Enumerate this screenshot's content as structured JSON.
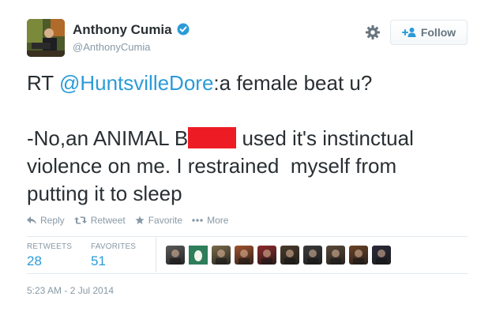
{
  "author": {
    "name": "Anthony Cumia",
    "handle": "@AnthonyCumia",
    "verified": true
  },
  "header": {
    "follow_label": "Follow"
  },
  "tweet": {
    "line1_prefix": "RT ",
    "mention": "@HuntsvilleDore",
    "line1_suffix": ":a female beat u?",
    "line2_before": "-No,an ANIMAL B",
    "line2_after": " used it's instinctual",
    "line3": "violence on me. I restrained  myself from",
    "line4": "putting it to sleep",
    "redaction_color": "#ed1c24"
  },
  "actions": {
    "reply": "Reply",
    "retweet": "Retweet",
    "favorite": "Favorite",
    "more": "More"
  },
  "stats": {
    "retweets_label": "RETWEETS",
    "retweets_count": "28",
    "favorites_label": "FAVORITES",
    "favorites_count": "51"
  },
  "favoriters": [
    {
      "color": "#5a5a5a"
    },
    {
      "color": "#2e7d5b"
    },
    {
      "color": "#7a6a4a"
    },
    {
      "color": "#a0522d"
    },
    {
      "color": "#8b2a2a"
    },
    {
      "color": "#4a3a2a"
    },
    {
      "color": "#3a3a3a"
    },
    {
      "color": "#5b4a3a"
    },
    {
      "color": "#6b4226"
    },
    {
      "color": "#2a2a3a"
    }
  ],
  "timestamp": "5:23 AM - 2 Jul 2014",
  "colors": {
    "link": "#2b9bd8",
    "muted": "#8899a6",
    "text": "#292f33",
    "border": "#e1e8ed"
  }
}
